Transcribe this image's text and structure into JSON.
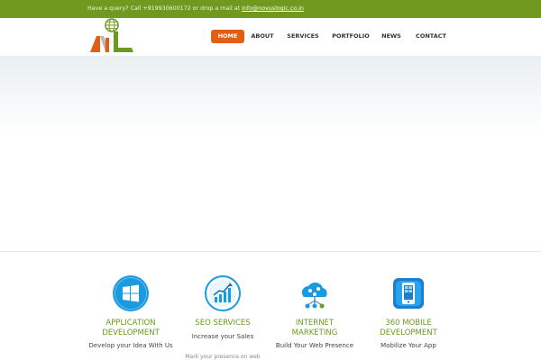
{
  "topbar": {
    "message": "Have a query? Call +919930600172 or drop a mail at ",
    "email": "info@novuslogic.co.in"
  },
  "nav": {
    "items": [
      {
        "label": "HOME",
        "active": true
      },
      {
        "label": "ABOUT",
        "active": false
      },
      {
        "label": "SERVICES",
        "active": false
      },
      {
        "label": "PORTFOLIO",
        "active": false
      },
      {
        "label": "NEWS",
        "active": false
      },
      {
        "label": "CONTACT",
        "active": false
      }
    ]
  },
  "services": [
    {
      "icon": "windows-icon",
      "title_line1": "APPLICATION",
      "title_line2": "DEVELOPMENT",
      "desc": "Develop your Idea With Us"
    },
    {
      "icon": "growth-chart-icon",
      "title_line1": "SEO SERVICES",
      "title_line2": "",
      "desc": "Increase your Sales",
      "more": "Mark your presence on web"
    },
    {
      "icon": "cloud-network-icon",
      "title_line1": "INTERNET",
      "title_line2": "MARKETING",
      "desc": "Build Your Web Presence"
    },
    {
      "icon": "mobile-phone-icon",
      "title_line1": "360 MOBILE",
      "title_line2": "DEVELOPMENT",
      "desc": "Mobilize Your App"
    }
  ],
  "colors": {
    "topbar": "#6f9a1f",
    "accent": "#e05f14",
    "service_title": "#6a9a1f",
    "icon_blue": "#1a9be0"
  }
}
